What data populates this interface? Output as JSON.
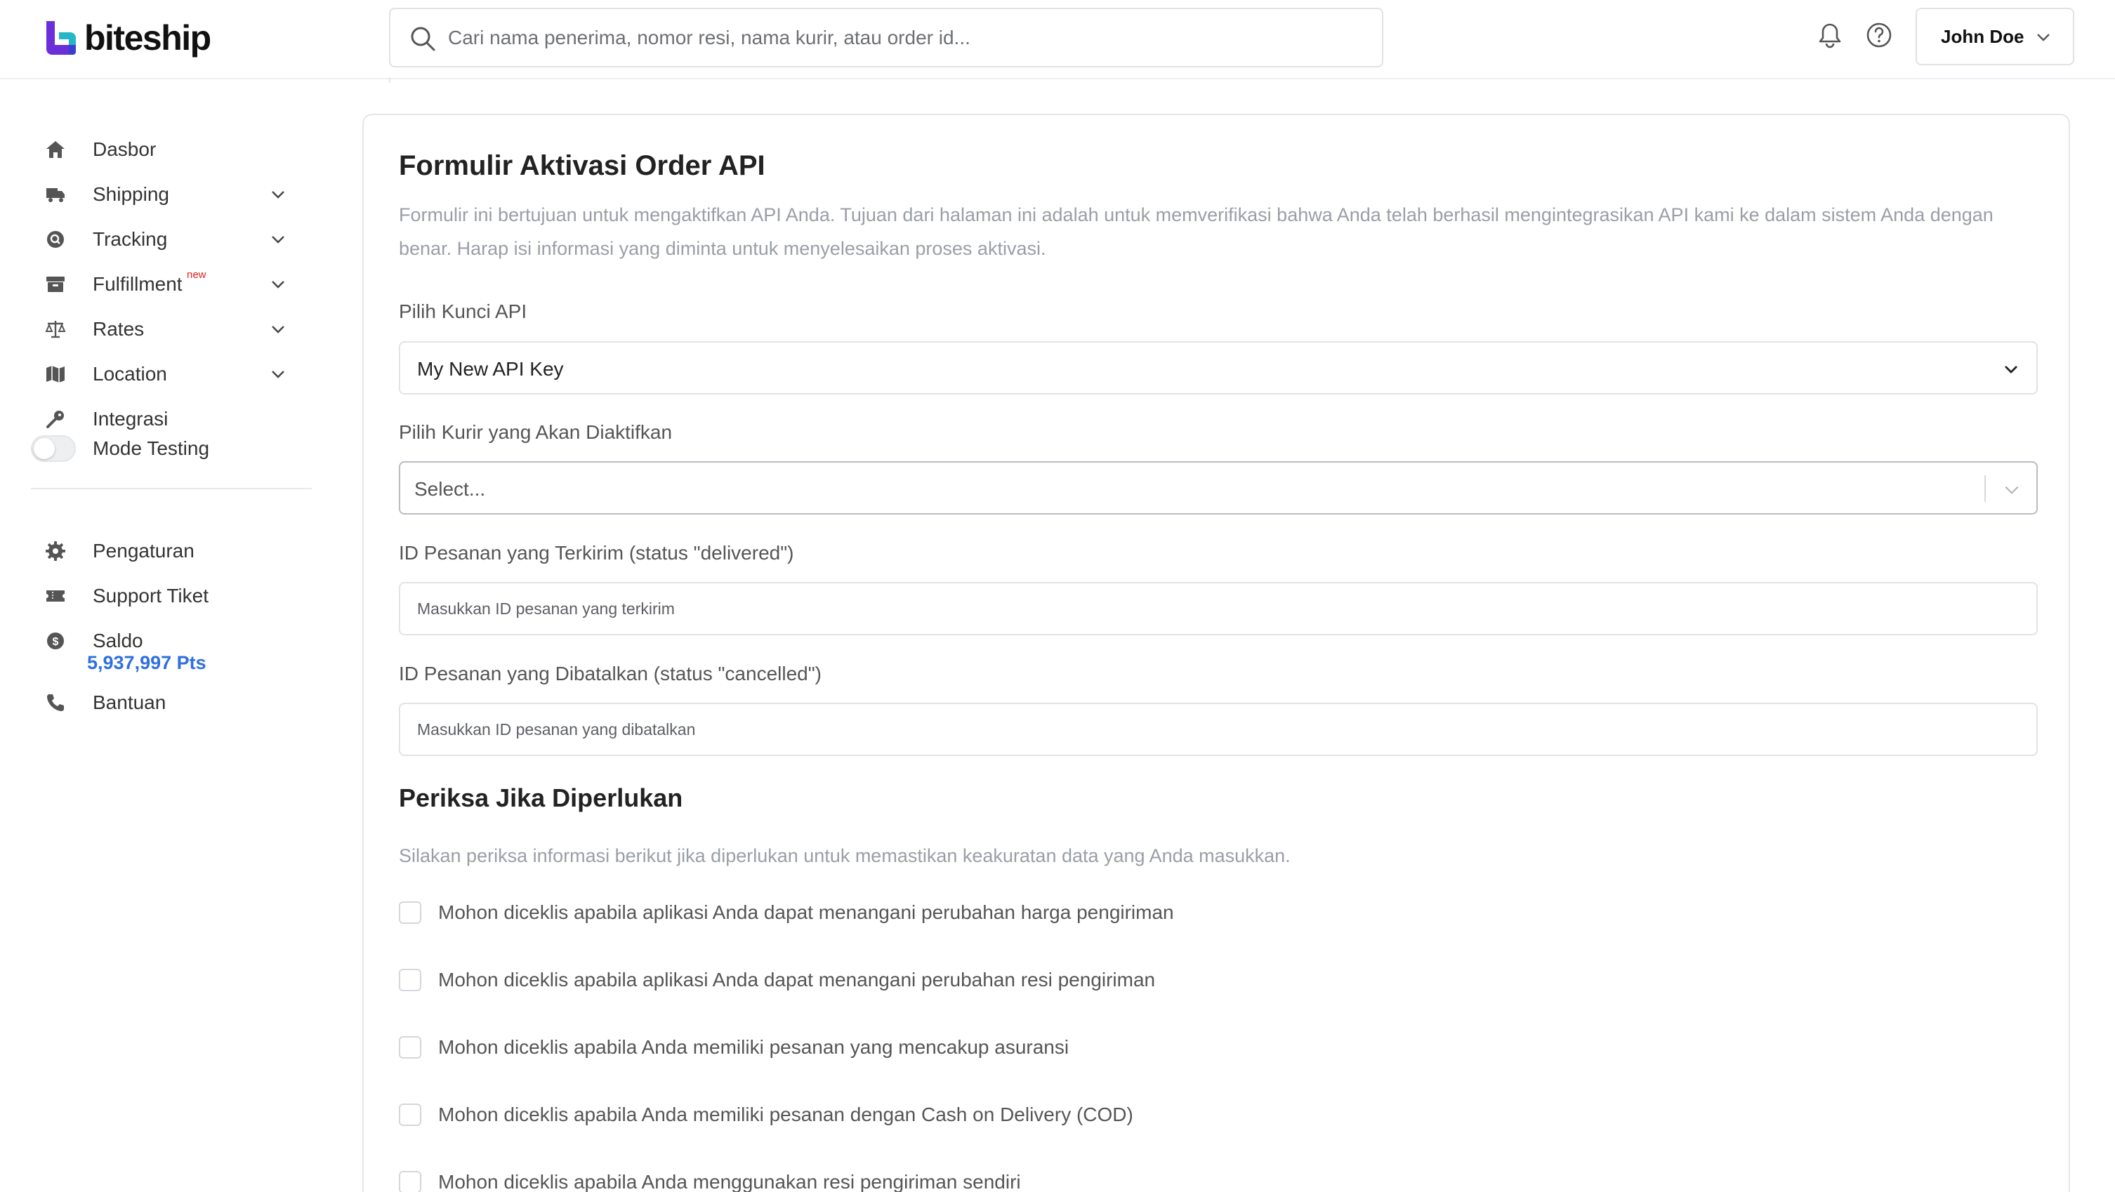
{
  "header": {
    "brand": "biteship",
    "search_placeholder": "Cari nama penerima, nomor resi, nama kurir, atau order id...",
    "user_name": "John Doe",
    "icons": {
      "search": "search-icon",
      "notifications": "bell-icon",
      "help": "help-circle-icon",
      "user_menu": "chevron-down-icon"
    }
  },
  "sidebar": {
    "items": [
      {
        "label": "Dasbor",
        "icon": "home-icon"
      },
      {
        "label": "Shipping",
        "icon": "truck-icon"
      },
      {
        "label": "Tracking",
        "icon": "tracking-icon"
      },
      {
        "label": "Fulfillment",
        "icon": "archive-box-icon",
        "badge": "new"
      },
      {
        "label": "Rates",
        "icon": "scale-icon"
      },
      {
        "label": "Location",
        "icon": "map-icon"
      },
      {
        "label": "Integrasi",
        "icon": "key-icon"
      }
    ],
    "mode_testing": {
      "label": "Mode Testing",
      "enabled": false
    },
    "bottom_items": [
      {
        "label": "Pengaturan",
        "icon": "gear-icon"
      },
      {
        "label": "Support Tiket",
        "icon": "ticket-icon"
      },
      {
        "label": "Saldo",
        "icon": "dollar-coin-icon"
      },
      {
        "label": "Bantuan",
        "icon": "phone-icon"
      }
    ],
    "balance": "5,937,997 Pts"
  },
  "form": {
    "title": "Formulir Aktivasi Order API",
    "description": "Formulir ini bertujuan untuk mengaktifkan API Anda. Tujuan dari halaman ini adalah untuk memverifikasi bahwa Anda telah berhasil mengintegrasikan API kami ke dalam sistem Anda dengan benar. Harap isi informasi yang diminta untuk menyelesaikan proses aktivasi.",
    "api_key": {
      "label": "Pilih Kunci API",
      "value": "My New API Key"
    },
    "courier": {
      "label": "Pilih Kurir yang Akan Diaktifkan",
      "placeholder": "Select..."
    },
    "delivered_id": {
      "label": "ID Pesanan yang Terkirim (status \"delivered\")",
      "placeholder": "Masukkan ID pesanan yang terkirim"
    },
    "cancelled_id": {
      "label": "ID Pesanan yang Dibatalkan (status \"cancelled\")",
      "placeholder": "Masukkan ID pesanan yang dibatalkan"
    },
    "checks": {
      "title": "Periksa Jika Diperlukan",
      "description": "Silakan periksa informasi berikut jika diperlukan untuk memastikan keakuratan data yang Anda masukkan.",
      "items": [
        {
          "label": "Mohon diceklis apabila aplikasi Anda dapat menangani perubahan harga pengiriman",
          "checked": false
        },
        {
          "label": "Mohon diceklis apabila aplikasi Anda dapat menangani perubahan resi pengiriman",
          "checked": false
        },
        {
          "label": "Mohon diceklis apabila Anda memiliki pesanan yang mencakup asuransi",
          "checked": false
        },
        {
          "label": "Mohon diceklis apabila Anda memiliki pesanan dengan Cash on Delivery (COD)",
          "checked": false
        },
        {
          "label": "Mohon diceklis apabila Anda menggunakan resi pengiriman sendiri",
          "checked": false
        }
      ]
    }
  },
  "colors": {
    "brand_purple": "#6a2fd8",
    "brand_teal": "#25b6c8",
    "balance_blue": "#2f6fe0",
    "badge_red": "#e02020"
  }
}
